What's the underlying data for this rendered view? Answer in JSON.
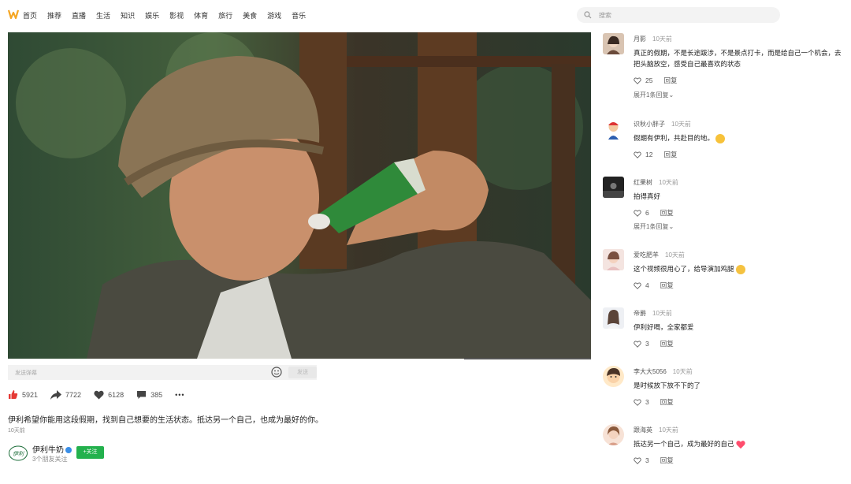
{
  "nav": {
    "items": [
      "首页",
      "推荐",
      "直播",
      "生活",
      "知识",
      "娱乐",
      "影视",
      "体育",
      "旅行",
      "美食",
      "游戏",
      "音乐"
    ]
  },
  "search": {
    "placeholder": "搜索"
  },
  "colors": {
    "brand": "#f5a623",
    "follow": "#23b14d",
    "like": "#e53935",
    "heart_emoji": "#ff4d6d"
  },
  "danmu": {
    "placeholder": "发送弹幕",
    "send_label": "发送"
  },
  "actions": {
    "likes": "5921",
    "shares": "7722",
    "favorites": "6128",
    "comments": "385",
    "more": "•••"
  },
  "video_info": {
    "description": "伊利希望你能用这段假期，找到自己想要的生活状态。抵达另一个自己，也成为最好的你。",
    "time": "10天前"
  },
  "author": {
    "name": "伊利牛奶",
    "follow_label": "+关注",
    "subtitle": "3个朋友关注",
    "logo_text": "伊利"
  },
  "comments": [
    {
      "user": "月影",
      "time": "10天前",
      "text": "真正的假期，不是长途跋涉，不是景点打卡，而是给自己一个机会，去把头脑放空，感受自己最喜欢的状态",
      "likes": "25",
      "reply": "回复",
      "expand": "展开1条回复⌄"
    },
    {
      "user": "识秋小胖子",
      "time": "10天前",
      "text": "假期有伊利，共赴目的地。",
      "likes": "12",
      "reply": "回复"
    },
    {
      "user": "红果树",
      "time": "10天前",
      "text": "拍得真好",
      "likes": "6",
      "reply": "回复",
      "expand": "展开1条回复⌄"
    },
    {
      "user": "爱吃肥羊",
      "time": "10天前",
      "text": "这个视频很用心了，给导演加鸡腿",
      "likes": "4",
      "reply": "回复"
    },
    {
      "user": "帝爵",
      "time": "10天前",
      "text": "伊利好喝，全家都爱",
      "likes": "3",
      "reply": "回复"
    },
    {
      "user": "李大大5056",
      "time": "10天前",
      "text": "是时候放下放不下的了",
      "likes": "3",
      "reply": "回复"
    },
    {
      "user": "跟海英",
      "time": "10天前",
      "text": "抵达另一个自己，成为最好的自己",
      "likes": "3",
      "reply": "回复"
    }
  ]
}
